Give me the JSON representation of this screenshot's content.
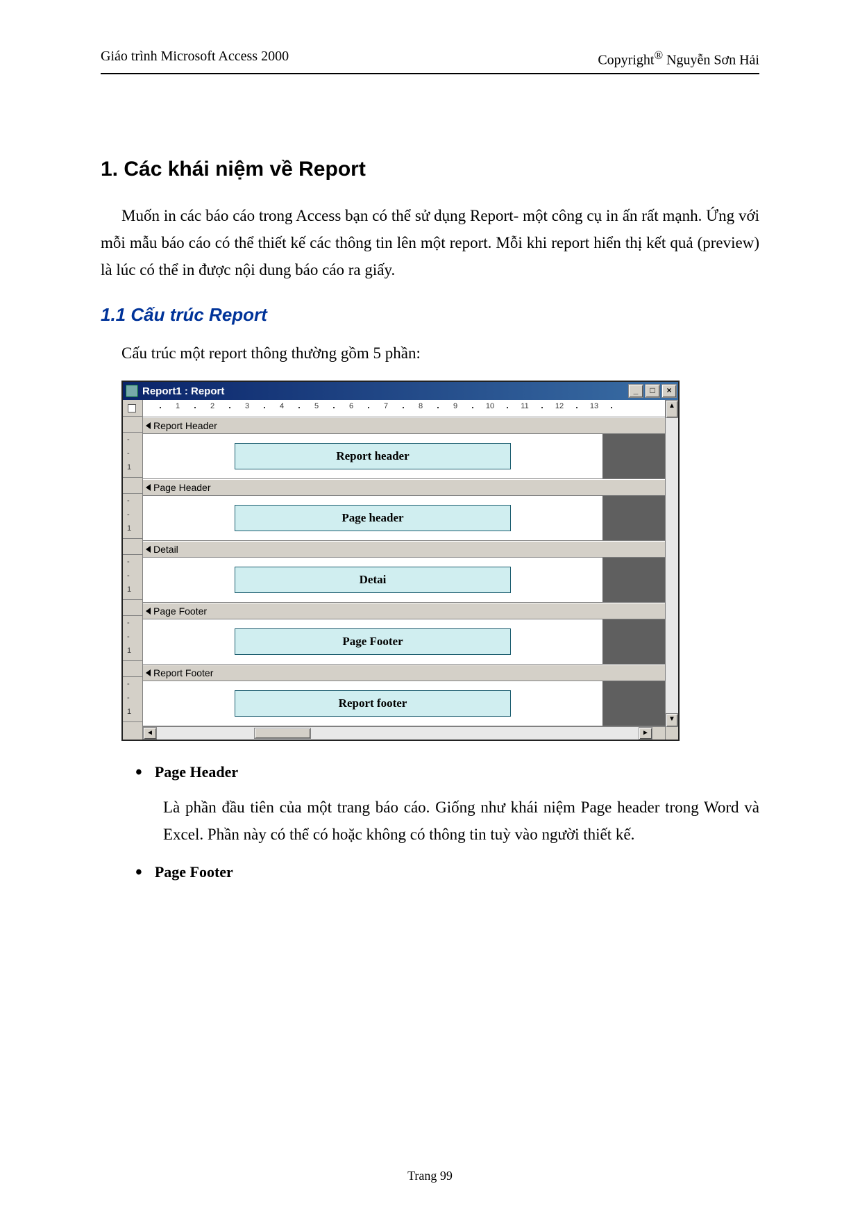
{
  "header": {
    "left": "Giáo trình Microsoft Access 2000",
    "right_prefix": "Copyright",
    "right_sup": "®",
    "right_suffix": " Nguyễn Sơn Hải"
  },
  "h1": "1. Các khái niệm về Report",
  "p1": "Muốn in các báo cáo trong Access bạn có thể sử dụng Report- một công cụ in ấn rất mạnh. Ứng với mỗi mẫu báo cáo có thể thiết kế các thông tin lên một report. Mỗi khi report hiển thị kết quả (preview) là lúc có thể in được nội dung báo cáo ra giấy.",
  "h2": "1.1 Cấu trúc Report",
  "p2": "Cấu trúc một report thông thường gồm 5 phần:",
  "window": {
    "title": "Report1 : Report",
    "btn_min": "_",
    "btn_max": "□",
    "btn_close": "×",
    "ruler_numbers": [
      "1",
      "2",
      "3",
      "4",
      "5",
      "6",
      "7",
      "8",
      "9",
      "10",
      "11",
      "12",
      "13"
    ],
    "sections": [
      {
        "name": "Report Header",
        "block": "Report header"
      },
      {
        "name": "Page Header",
        "block": "Page header"
      },
      {
        "name": "Detail",
        "block": "Detai"
      },
      {
        "name": "Page Footer",
        "block": "Page Footer"
      },
      {
        "name": "Report Footer",
        "block": "Report footer"
      }
    ],
    "vticks": [
      "-",
      "-",
      "1"
    ],
    "scroll_up": "▲",
    "scroll_down": "▼",
    "scroll_left": "◄",
    "scroll_right": "►"
  },
  "bullets": [
    {
      "head": "Page Header",
      "text": "Là phần đầu tiên của một trang báo cáo. Giống như khái niệm Page header trong Word và Excel. Phần này có thể có hoặc không có thông tin tuỳ vào người thiết kế."
    },
    {
      "head": "Page Footer",
      "text": ""
    }
  ],
  "footer": "Trang 99"
}
